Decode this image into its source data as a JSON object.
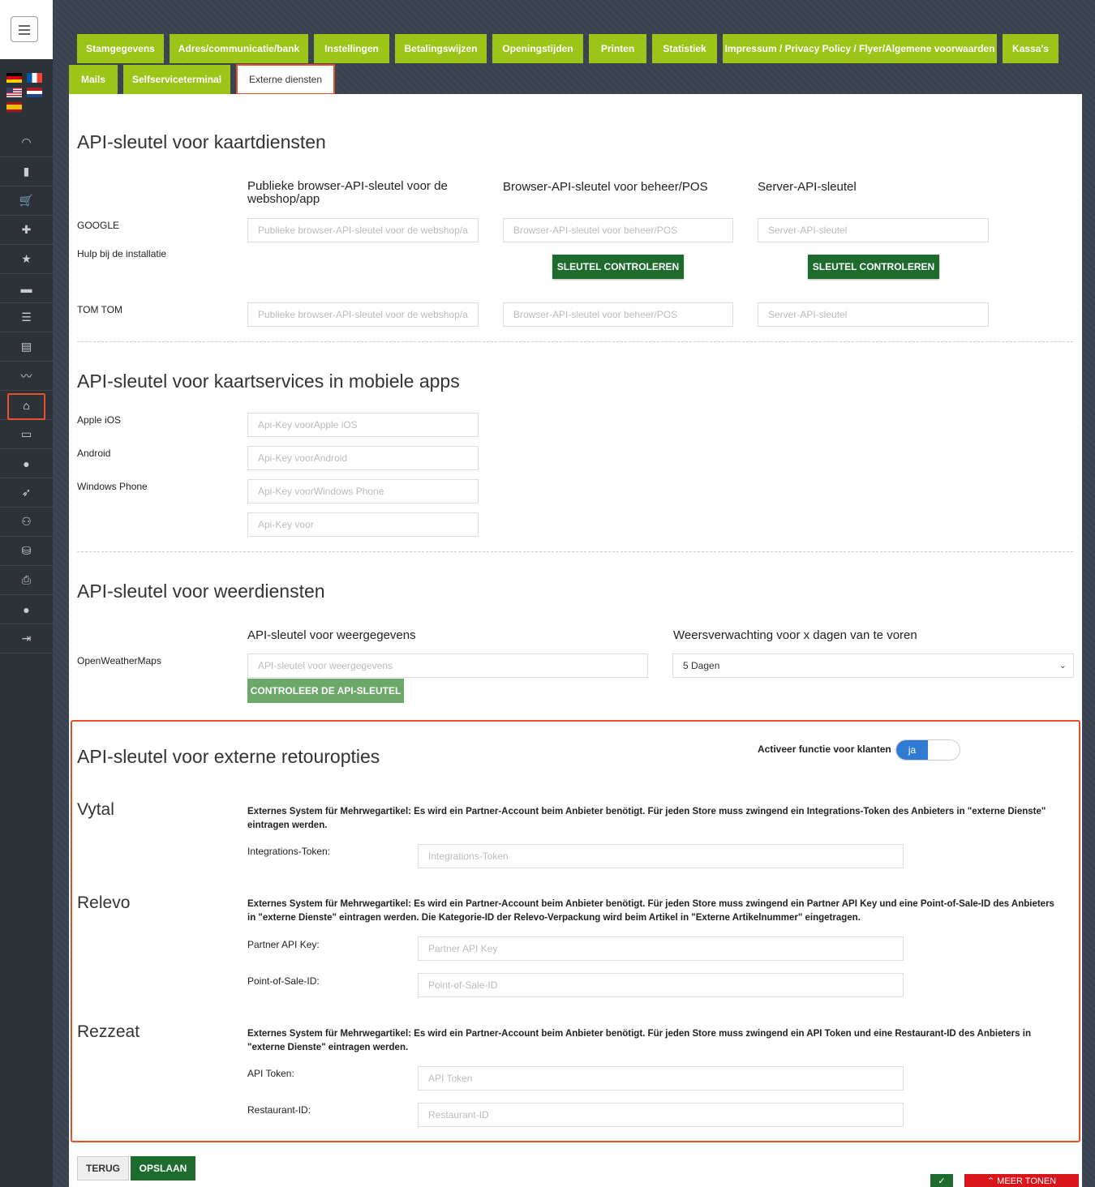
{
  "tabs_row1": [
    "Stamgegevens",
    "Adres/communicatie/bank",
    "Instellingen",
    "Betalingswijzen",
    "Openingstijden",
    "Printen",
    "Statistiek",
    "Impressum / Privacy Policy / Flyer/Algemene voorwaarden",
    "Kassa's"
  ],
  "tabs_row2": [
    "Mails",
    "Selfserviceterminal",
    "Externe diensten"
  ],
  "map_section": {
    "title": "API-sleutel voor kaartdiensten",
    "col1_header": "Publieke browser-API-sleutel voor de webshop/app",
    "col2_header": "Browser-API-sleutel voor beheer/POS",
    "col3_header": "Server-API-sleutel",
    "google_label": "GOOGLE",
    "help_label": "Hulp bij de installatie",
    "tomtom_label": "TOM TOM",
    "placeholder_public": "Publieke browser-API-sleutel voor de webshop/app",
    "placeholder_browser": "Browser-API-sleutel voor beheer/POS",
    "placeholder_server": "Server-API-sleutel",
    "check_button": "SLEUTEL CONTROLEREN"
  },
  "mobile_section": {
    "title": "API-sleutel voor kaartservices in mobiele apps",
    "ios_label": "Apple iOS",
    "android_label": "Android",
    "wp_label": "Windows Phone",
    "ios_placeholder": "Api-Key voorApple iOS",
    "android_placeholder": "Api-Key voorAndroid",
    "wp_placeholder": "Api-Key voorWindows Phone",
    "extra_placeholder": "Api-Key voor"
  },
  "weather_section": {
    "title": "API-sleutel voor weerdiensten",
    "provider_label": "OpenWeatherMaps",
    "key_header": "API-sleutel voor weergegevens",
    "key_placeholder": "API-sleutel voor weergegevens",
    "forecast_header": "Weersverwachting voor x dagen van te voren",
    "forecast_value": "5 Dagen",
    "check_button": "CONTROLEER DE API-SLEUTEL"
  },
  "retour_section": {
    "title": "API-sleutel voor externe retouropties",
    "activate_label": "Activeer functie voor klanten",
    "toggle_value": "ja",
    "vytal": {
      "name": "Vytal",
      "desc": "Externes System für Mehrwegartikel: Es wird ein Partner-Account beim Anbieter benötigt. Für jeden Store muss zwingend ein Integrations-Token des Anbieters in \"externe Dienste\" eintragen werden.",
      "token_label": "Integrations-Token:",
      "token_placeholder": "Integrations-Token"
    },
    "relevo": {
      "name": "Relevo",
      "desc": "Externes System für Mehrwegartikel: Es wird ein Partner-Account beim Anbieter benötigt. Für jeden Store muss zwingend ein Partner API Key und eine Point-of-Sale-ID des Anbieters in \"externe Dienste\" eintragen werden. Die Kategorie-ID der Relevo-Verpackung wird beim Artikel in \"Externe Artikelnummer\" eingetragen.",
      "key_label": "Partner API Key:",
      "key_placeholder": "Partner API Key",
      "pos_label": "Point-of-Sale-ID:",
      "pos_placeholder": "Point-of-Sale-ID"
    },
    "rezzeat": {
      "name": "Rezzeat",
      "desc": "Externes System für Mehrwegartikel: Es wird ein Partner-Account beim Anbieter benötigt. Für jeden Store muss zwingend ein API Token und eine Restaurant-ID des Anbieters in \"externe Dienste\" eintragen werden.",
      "token_label": "API Token:",
      "token_placeholder": "API Token",
      "rest_label": "Restaurant-ID:",
      "rest_placeholder": "Restaurant-ID"
    }
  },
  "footer": {
    "back_label": "TERUG",
    "save_label": "OPSLAAN",
    "phone_icon": "✓",
    "more_label": "⌃ MEER TONEN"
  },
  "colors": {
    "tab_green": "#9cc51a",
    "button_dark_green": "#1e6b2e",
    "highlight": "#e8502d",
    "toggle_blue": "#2f7bd4",
    "more_red": "#d9141b"
  }
}
